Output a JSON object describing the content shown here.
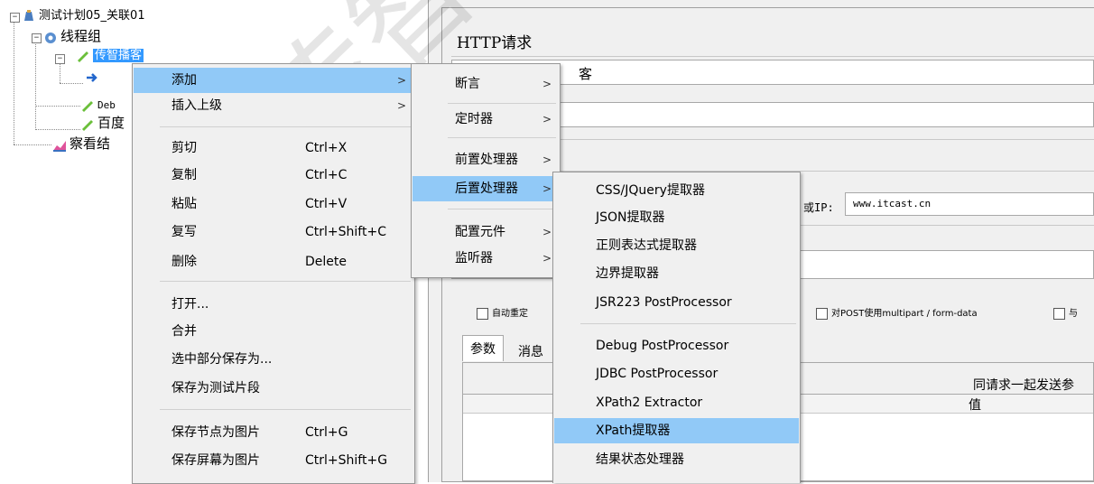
{
  "tree": {
    "root": "测试计划05_关联01",
    "thread_group": "线程组",
    "sampler_selected": "传智播客",
    "child_hidden": "",
    "debug": "Deb",
    "baidu": "百度",
    "view_results": "察看结"
  },
  "right_panel": {
    "title": "HTTP请求",
    "name_value": "客",
    "server_label": "或IP:",
    "server_value": "www.itcast.cn",
    "checkbox_auto_redirect": "自动重定",
    "checkbox_multipart": "对POST使用multipart / form-data",
    "checkbox_browser": "与",
    "tab_params": "参数",
    "tab_body": "消息",
    "send_with_request": "同请求一起发送参",
    "col_value": "值"
  },
  "menu1": {
    "items": [
      {
        "label": "添加",
        "shortcut": "",
        "submenu": true
      },
      {
        "label": "插入上级",
        "shortcut": "",
        "submenu": true
      },
      {
        "label": "剪切",
        "shortcut": "Ctrl+X"
      },
      {
        "label": "复制",
        "shortcut": "Ctrl+C"
      },
      {
        "label": "粘贴",
        "shortcut": "Ctrl+V"
      },
      {
        "label": "复写",
        "shortcut": "Ctrl+Shift+C"
      },
      {
        "label": "删除",
        "shortcut": "Delete"
      },
      {
        "label": "打开...",
        "shortcut": ""
      },
      {
        "label": "合并",
        "shortcut": ""
      },
      {
        "label": "选中部分保存为...",
        "shortcut": ""
      },
      {
        "label": "保存为测试片段",
        "shortcut": ""
      },
      {
        "label": "保存节点为图片",
        "shortcut": "Ctrl+G"
      },
      {
        "label": "保存屏幕为图片",
        "shortcut": "Ctrl+Shift+G"
      }
    ]
  },
  "menu2": {
    "items": [
      {
        "label": "断言"
      },
      {
        "label": "定时器"
      },
      {
        "label": "前置处理器"
      },
      {
        "label": "后置处理器"
      },
      {
        "label": "配置元件"
      },
      {
        "label": "监听器"
      }
    ]
  },
  "menu3": {
    "items": [
      {
        "label": "CSS/JQuery提取器"
      },
      {
        "label": "JSON提取器"
      },
      {
        "label": "正则表达式提取器"
      },
      {
        "label": "边界提取器"
      },
      {
        "label": "JSR223 PostProcessor"
      },
      {
        "label": "Debug PostProcessor"
      },
      {
        "label": "JDBC PostProcessor"
      },
      {
        "label": "XPath2 Extractor"
      },
      {
        "label": "XPath提取器"
      },
      {
        "label": "结果状态处理器"
      }
    ]
  },
  "submenu_arrow": ">",
  "watermark": "传智播客WWW",
  "colors": {
    "highlight": "#91c9f7",
    "selection": "#3399ff",
    "menu_bg": "#f0f0f0"
  }
}
